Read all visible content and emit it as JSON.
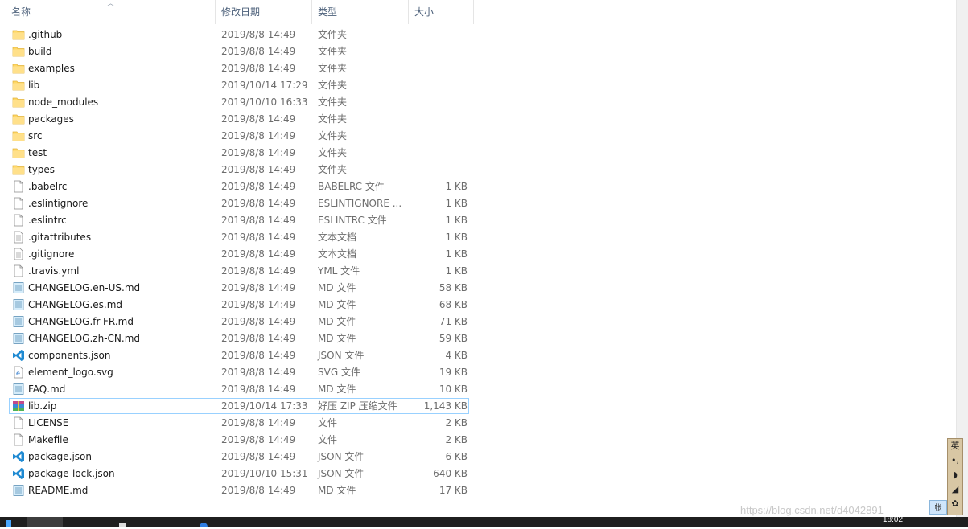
{
  "columns": {
    "name": "名称",
    "date": "修改日期",
    "type": "类型",
    "size": "大小"
  },
  "files": [
    {
      "name": ".github",
      "date": "2019/8/8 14:49",
      "type": "文件夹",
      "size": "",
      "icon": "folder-icon"
    },
    {
      "name": "build",
      "date": "2019/8/8 14:49",
      "type": "文件夹",
      "size": "",
      "icon": "folder-icon"
    },
    {
      "name": "examples",
      "date": "2019/8/8 14:49",
      "type": "文件夹",
      "size": "",
      "icon": "folder-icon"
    },
    {
      "name": "lib",
      "date": "2019/10/14 17:29",
      "type": "文件夹",
      "size": "",
      "icon": "folder-icon"
    },
    {
      "name": "node_modules",
      "date": "2019/10/10 16:33",
      "type": "文件夹",
      "size": "",
      "icon": "folder-icon"
    },
    {
      "name": "packages",
      "date": "2019/8/8 14:49",
      "type": "文件夹",
      "size": "",
      "icon": "folder-icon"
    },
    {
      "name": "src",
      "date": "2019/8/8 14:49",
      "type": "文件夹",
      "size": "",
      "icon": "folder-icon"
    },
    {
      "name": "test",
      "date": "2019/8/8 14:49",
      "type": "文件夹",
      "size": "",
      "icon": "folder-icon"
    },
    {
      "name": "types",
      "date": "2019/8/8 14:49",
      "type": "文件夹",
      "size": "",
      "icon": "folder-icon"
    },
    {
      "name": ".babelrc",
      "date": "2019/8/8 14:49",
      "type": "BABELRC 文件",
      "size": "1 KB",
      "icon": "blank-file-icon"
    },
    {
      "name": ".eslintignore",
      "date": "2019/8/8 14:49",
      "type": "ESLINTIGNORE ...",
      "size": "1 KB",
      "icon": "blank-file-icon"
    },
    {
      "name": ".eslintrc",
      "date": "2019/8/8 14:49",
      "type": "ESLINTRC 文件",
      "size": "1 KB",
      "icon": "blank-file-icon"
    },
    {
      "name": ".gitattributes",
      "date": "2019/8/8 14:49",
      "type": "文本文档",
      "size": "1 KB",
      "icon": "text-file-icon"
    },
    {
      "name": ".gitignore",
      "date": "2019/8/8 14:49",
      "type": "文本文档",
      "size": "1 KB",
      "icon": "text-file-icon"
    },
    {
      "name": ".travis.yml",
      "date": "2019/8/8 14:49",
      "type": "YML 文件",
      "size": "1 KB",
      "icon": "blank-file-icon"
    },
    {
      "name": "CHANGELOG.en-US.md",
      "date": "2019/8/8 14:49",
      "type": "MD 文件",
      "size": "58 KB",
      "icon": "markdown-file-icon"
    },
    {
      "name": "CHANGELOG.es.md",
      "date": "2019/8/8 14:49",
      "type": "MD 文件",
      "size": "68 KB",
      "icon": "markdown-file-icon"
    },
    {
      "name": "CHANGELOG.fr-FR.md",
      "date": "2019/8/8 14:49",
      "type": "MD 文件",
      "size": "71 KB",
      "icon": "markdown-file-icon"
    },
    {
      "name": "CHANGELOG.zh-CN.md",
      "date": "2019/8/8 14:49",
      "type": "MD 文件",
      "size": "59 KB",
      "icon": "markdown-file-icon"
    },
    {
      "name": "components.json",
      "date": "2019/8/8 14:49",
      "type": "JSON 文件",
      "size": "4 KB",
      "icon": "vscode-file-icon"
    },
    {
      "name": "element_logo.svg",
      "date": "2019/8/8 14:49",
      "type": "SVG 文件",
      "size": "19 KB",
      "icon": "svg-file-icon"
    },
    {
      "name": "FAQ.md",
      "date": "2019/8/8 14:49",
      "type": "MD 文件",
      "size": "10 KB",
      "icon": "markdown-file-icon"
    },
    {
      "name": "lib.zip",
      "date": "2019/10/14 17:33",
      "type": "好压 ZIP 压缩文件",
      "size": "1,143 KB",
      "icon": "zip-archive-icon",
      "selected": true
    },
    {
      "name": "LICENSE",
      "date": "2019/8/8 14:49",
      "type": "文件",
      "size": "2 KB",
      "icon": "blank-file-icon"
    },
    {
      "name": "Makefile",
      "date": "2019/8/8 14:49",
      "type": "文件",
      "size": "2 KB",
      "icon": "blank-file-icon"
    },
    {
      "name": "package.json",
      "date": "2019/8/8 14:49",
      "type": "JSON 文件",
      "size": "6 KB",
      "icon": "vscode-file-icon"
    },
    {
      "name": "package-lock.json",
      "date": "2019/10/10 15:31",
      "type": "JSON 文件",
      "size": "640 KB",
      "icon": "vscode-file-icon"
    },
    {
      "name": "README.md",
      "date": "2019/8/8 14:49",
      "type": "MD 文件",
      "size": "17 KB",
      "icon": "markdown-file-icon"
    }
  ],
  "ime": {
    "mode": "英",
    "tag": "帐"
  },
  "taskbar": {
    "clock": "18:02"
  },
  "watermark": "https://blog.csdn.net/d4042891",
  "colors": {
    "header_text": "#4c607a",
    "selection_border": "#99d1ff",
    "folder": "#ffd766",
    "vscode_blue": "#1f8ad2"
  }
}
